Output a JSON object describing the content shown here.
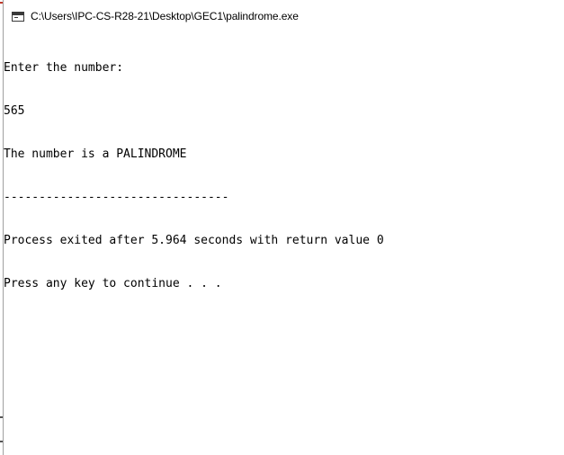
{
  "window": {
    "title": "C:\\Users\\IPC-CS-R28-21\\Desktop\\GEC1\\palindrome.exe",
    "icon": "console-window-icon"
  },
  "console": {
    "lines": [
      "Enter the number:",
      "565",
      "The number is a PALINDROME",
      "--------------------------------",
      "Process exited after 5.964 seconds with return value 0",
      "Press any key to continue . . ."
    ]
  }
}
